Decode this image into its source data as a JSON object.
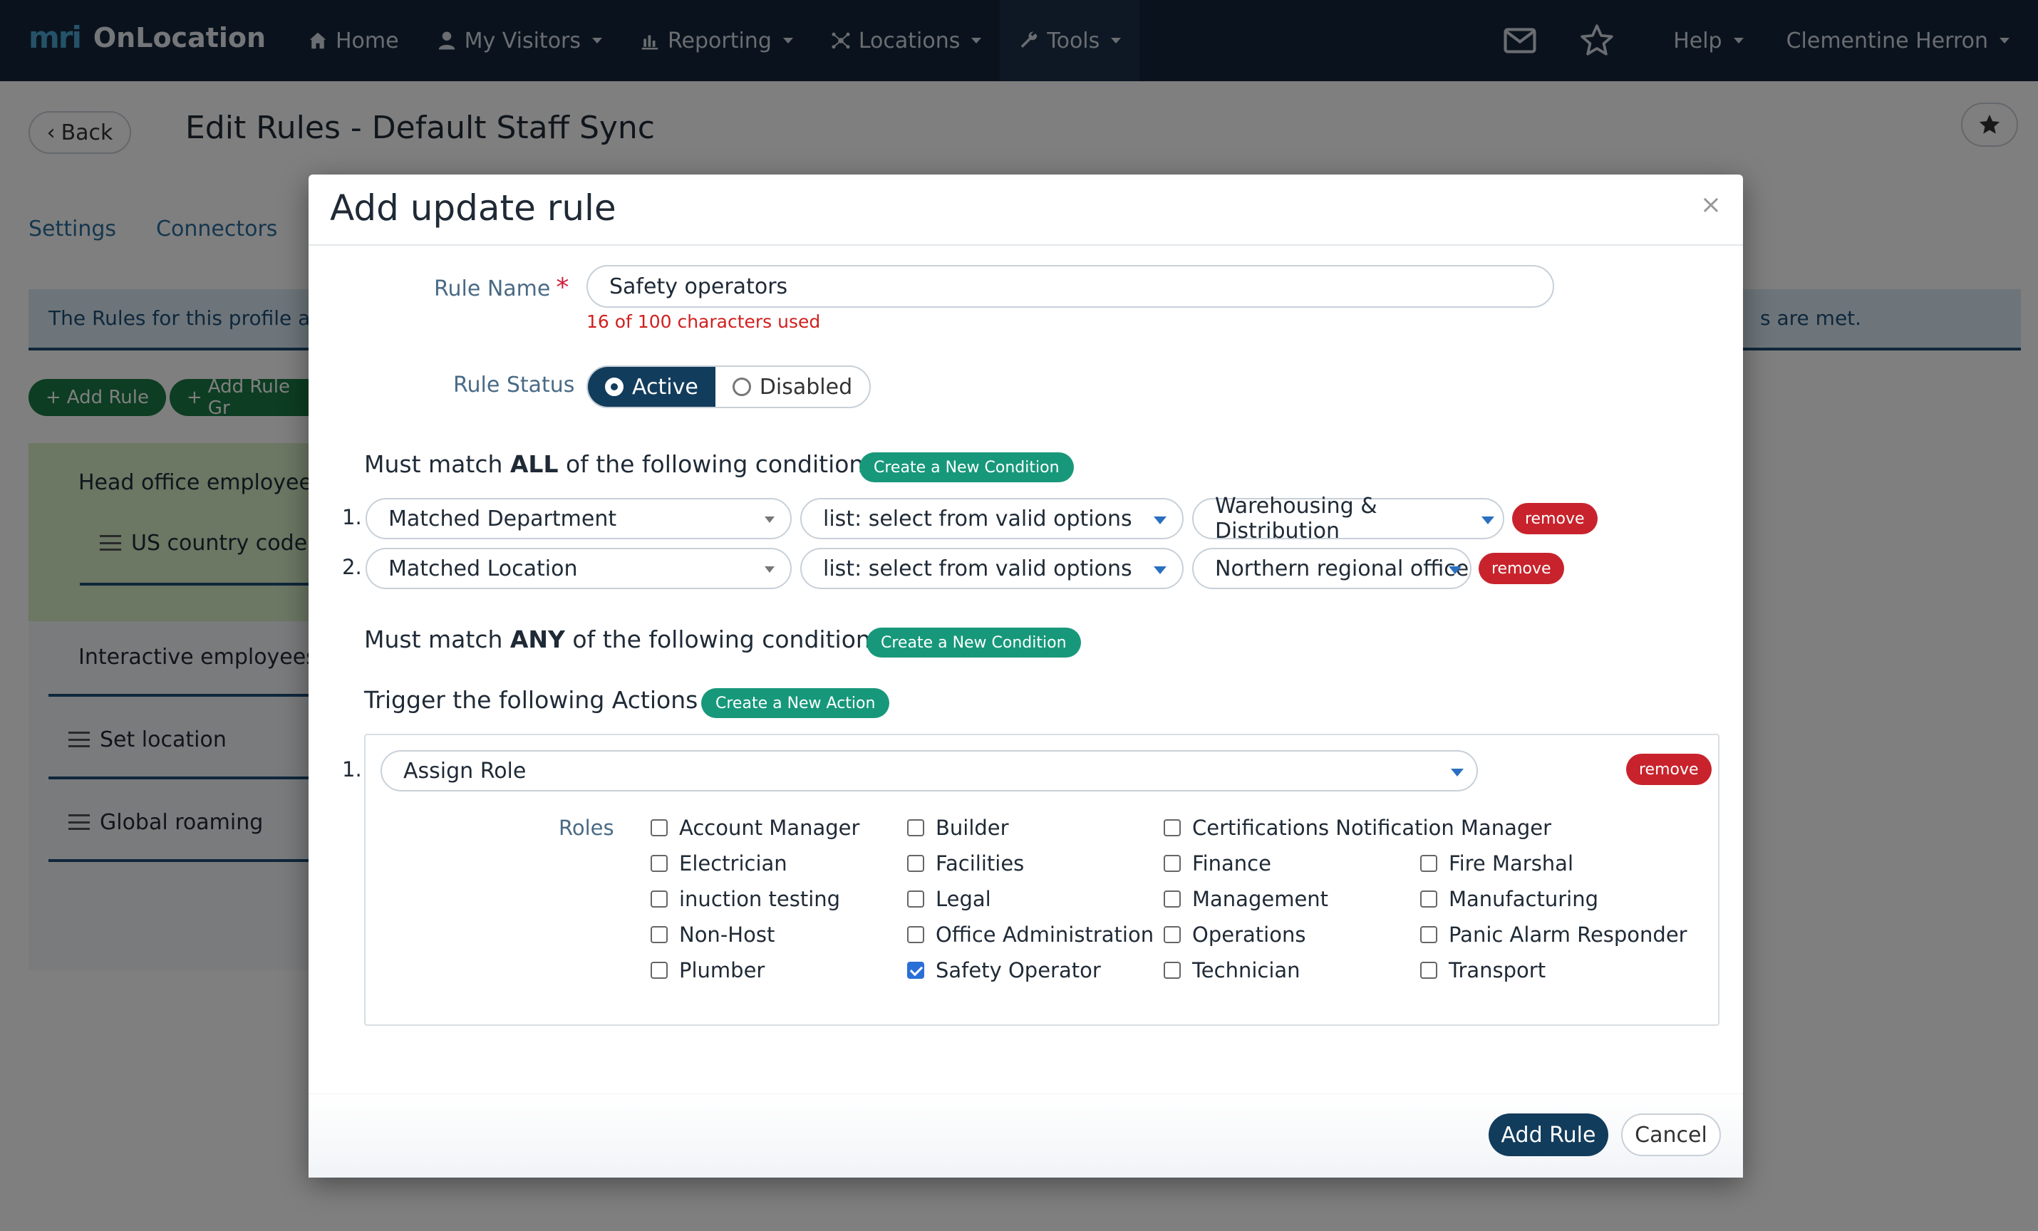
{
  "brand": {
    "logo": "mri",
    "name": "OnLocation"
  },
  "nav": {
    "items": [
      {
        "label": "Home",
        "icon": "home-icon"
      },
      {
        "label": "My Visitors",
        "icon": "user-icon"
      },
      {
        "label": "Reporting",
        "icon": "bar-chart-icon"
      },
      {
        "label": "Locations",
        "icon": "network-icon"
      },
      {
        "label": "Tools",
        "icon": "wrench-icon"
      }
    ],
    "help": "Help",
    "user": "Clementine Herron"
  },
  "page": {
    "back_label": "Back",
    "title": "Edit Rules - Default Staff Sync",
    "tabs": [
      "Settings",
      "Connectors"
    ],
    "banner_left": "The Rules for this profile are",
    "banner_right": "s are met.",
    "add_rule_label": "Add Rule",
    "add_rule_group_label": "Add Rule Gr",
    "rules": [
      "Head office employees",
      "US country code",
      "Interactive employees",
      "Set location",
      "Global roaming"
    ]
  },
  "modal": {
    "title": "Add update rule",
    "close": "×",
    "rule_name": {
      "label": "Rule Name",
      "required_mark": "*",
      "value": "Safety operators",
      "char_count": "16 of 100 characters used"
    },
    "rule_status": {
      "label": "Rule Status",
      "options": [
        "Active",
        "Disabled"
      ],
      "selected": "Active"
    },
    "all_conditions": {
      "prefix": "Must match ",
      "emph": "ALL",
      "suffix": " of the following conditions",
      "create_label": "Create a New Condition",
      "rows": [
        {
          "num": "1.",
          "field": "Matched Department",
          "operator": "list: select from valid options",
          "value": "Warehousing & Distribution",
          "remove": "remove"
        },
        {
          "num": "2.",
          "field": "Matched Location",
          "operator": "list: select from valid options",
          "value": "Northern regional office",
          "remove": "remove"
        }
      ]
    },
    "any_conditions": {
      "prefix": "Must match ",
      "emph": "ANY",
      "suffix": " of the following conditions",
      "create_label": "Create a New Condition"
    },
    "actions": {
      "title": "Trigger the following Actions",
      "create_label": "Create a New Action",
      "rows": [
        {
          "num": "1.",
          "action": "Assign Role",
          "remove": "remove"
        }
      ],
      "roles_label": "Roles",
      "roles": [
        {
          "name": "Account Manager",
          "checked": false
        },
        {
          "name": "Builder",
          "checked": false
        },
        {
          "name": "Certifications Notification Manager",
          "checked": false
        },
        {
          "name": "Electrician",
          "checked": false
        },
        {
          "name": "Facilities",
          "checked": false
        },
        {
          "name": "Finance",
          "checked": false
        },
        {
          "name": "Fire Marshal",
          "checked": false
        },
        {
          "name": "inuction testing",
          "checked": false
        },
        {
          "name": "Legal",
          "checked": false
        },
        {
          "name": "Management",
          "checked": false
        },
        {
          "name": "Manufacturing",
          "checked": false
        },
        {
          "name": "Non-Host",
          "checked": false
        },
        {
          "name": "Office Administration",
          "checked": false
        },
        {
          "name": "Operations",
          "checked": false
        },
        {
          "name": "Panic Alarm Responder",
          "checked": false
        },
        {
          "name": "Plumber",
          "checked": false
        },
        {
          "name": "Safety Operator",
          "checked": true
        },
        {
          "name": "Technician",
          "checked": false
        },
        {
          "name": "Transport",
          "checked": false
        }
      ]
    },
    "footer": {
      "submit_label": "Add Rule",
      "cancel_label": "Cancel"
    }
  },
  "colors": {
    "nav_bg": "#14263a",
    "primary": "#123c5c",
    "teal": "#17987a",
    "danger": "#c8232c",
    "checkbox_checked": "#2a6fd8"
  }
}
